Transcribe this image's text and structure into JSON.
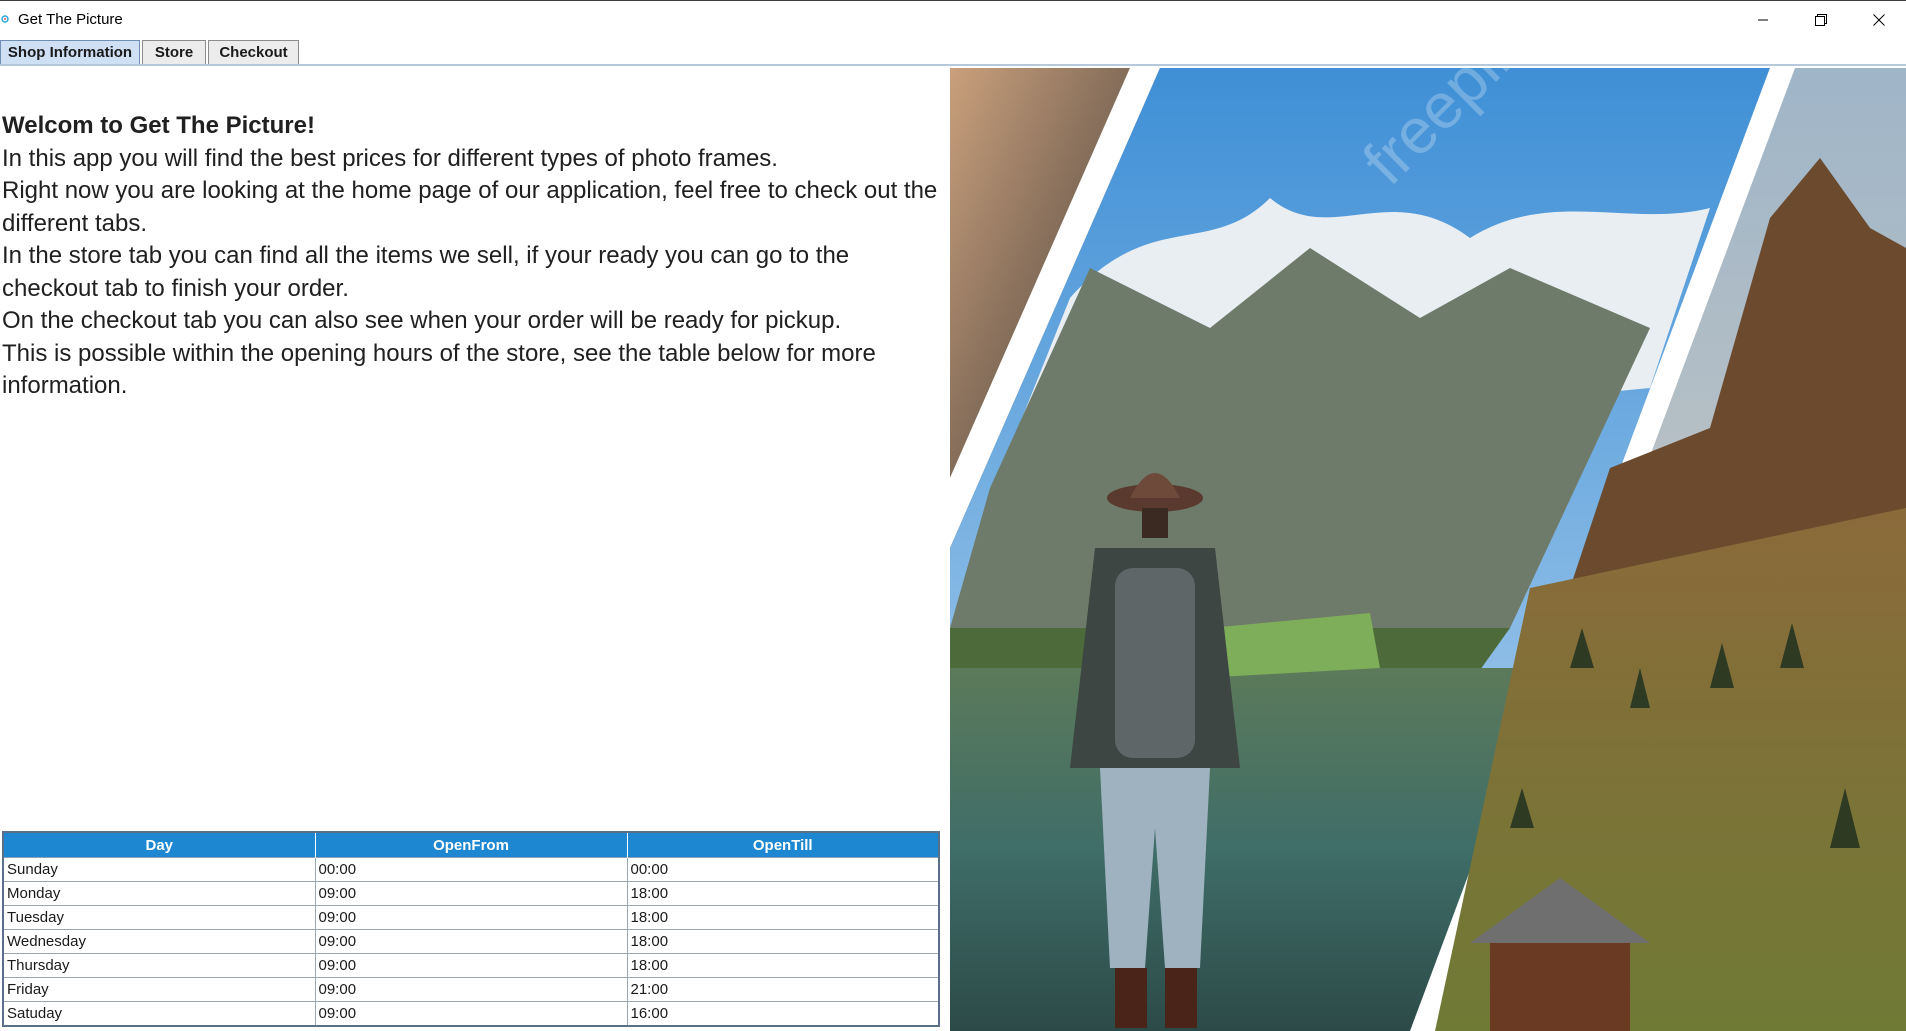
{
  "window": {
    "title": "Get The Picture",
    "minimize_icon": "minimize-icon",
    "maximize_icon": "restore-icon",
    "close_icon": "close-icon"
  },
  "tabs": [
    {
      "label": "Shop Information",
      "active": true
    },
    {
      "label": "Store",
      "active": false
    },
    {
      "label": "Checkout",
      "active": false
    }
  ],
  "intro": {
    "heading": "Welcom to Get The Picture!",
    "lines": [
      "In this app you will find the best prices for different types of photo frames.",
      "Right now you are looking at the home page of our application, feel free to check out the different tabs.",
      "In the store tab you can find all the items we sell, if your ready you can go to the checkout tab to finish your order.",
      "On the checkout tab you can also see when your order will be ready for pickup.",
      "This is possible within the opening hours of the store, see the table below for more information."
    ]
  },
  "hours_table": {
    "headers": [
      "Day",
      "OpenFrom",
      "OpenTill"
    ],
    "rows": [
      [
        "Sunday",
        "00:00",
        "00:00"
      ],
      [
        "Monday",
        "09:00",
        "18:00"
      ],
      [
        "Tuesday",
        "09:00",
        "18:00"
      ],
      [
        "Wednesday",
        "09:00",
        "18:00"
      ],
      [
        "Thursday",
        "09:00",
        "18:00"
      ],
      [
        "Friday",
        "09:00",
        "21:00"
      ],
      [
        "Satuday",
        "09:00",
        "16:00"
      ]
    ]
  },
  "colors": {
    "table_header": "#1e87d2",
    "active_tab": "#cfe0f4"
  },
  "image": {
    "subject": "hiker-with-backpack-mountain-lake-collage",
    "watermark": "freepik"
  }
}
